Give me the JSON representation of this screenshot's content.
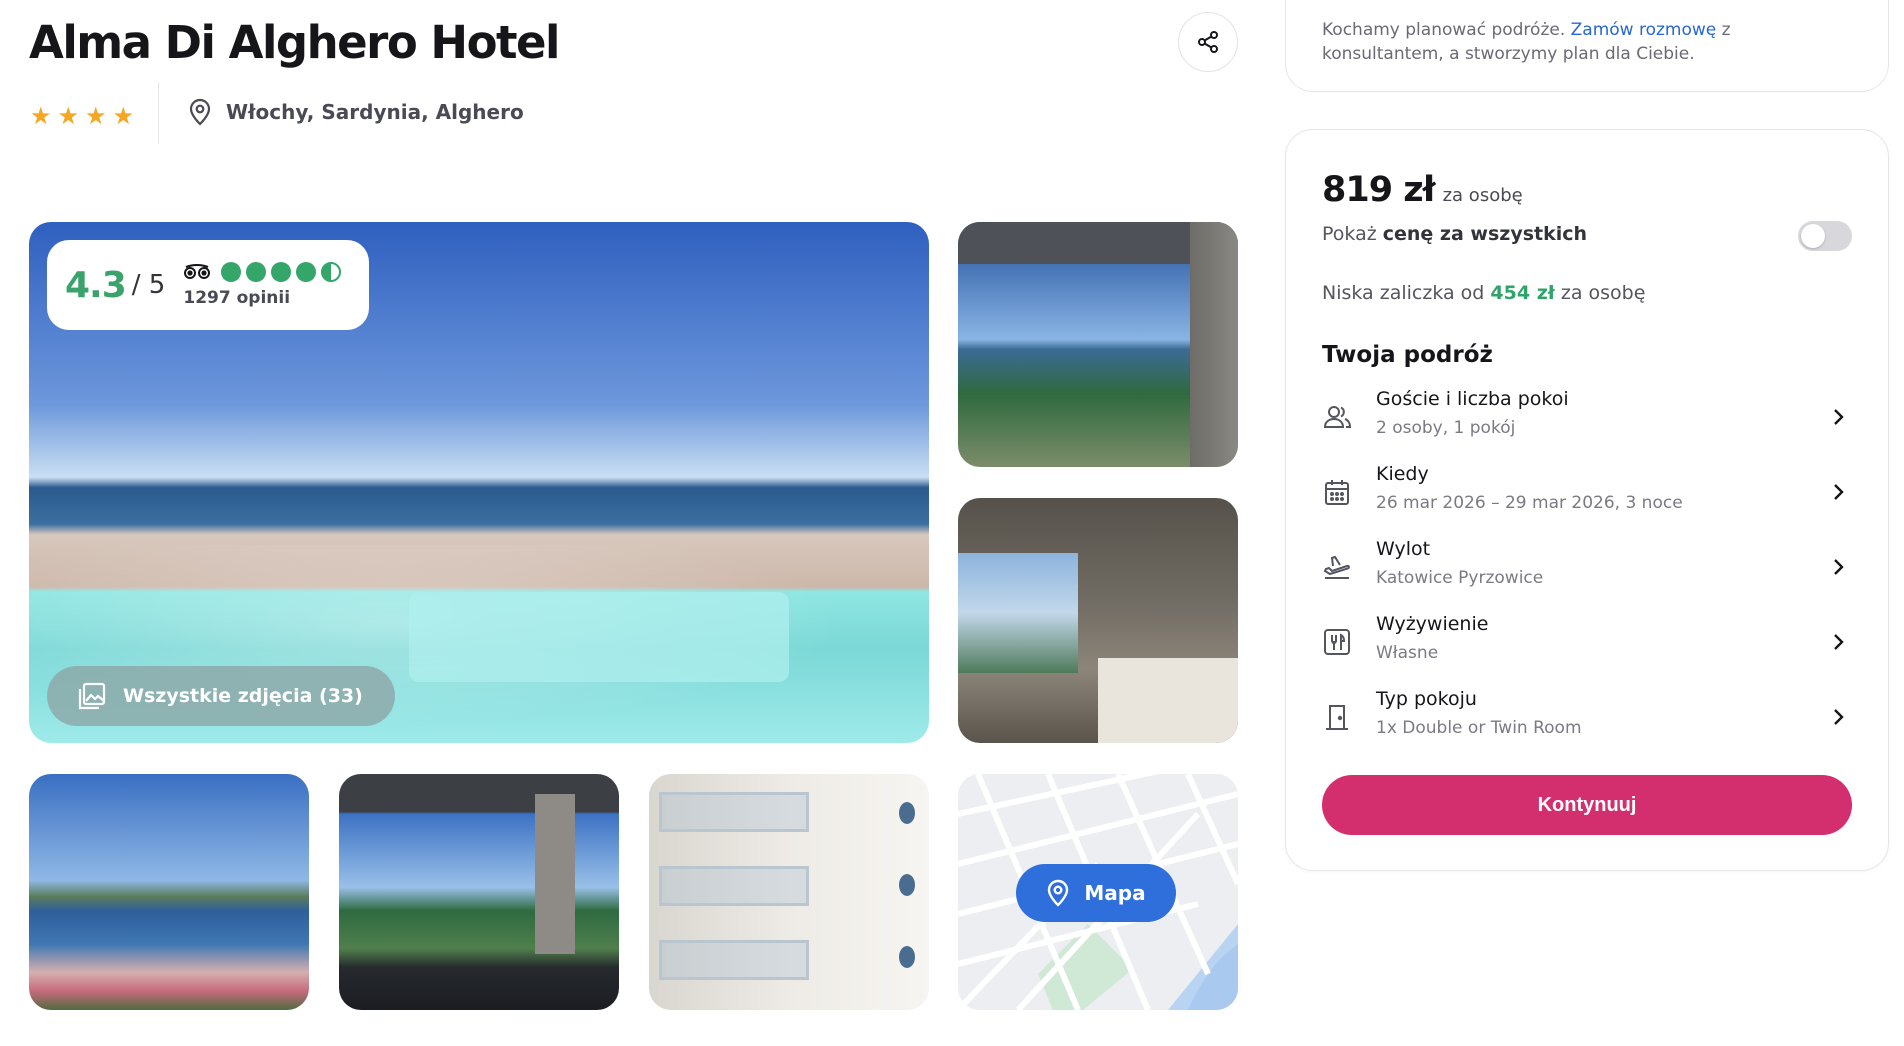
{
  "hotel": {
    "name": "Alma Di Alghero Hotel",
    "stars": 4,
    "star_glyph": "★",
    "location": "Włochy, Sardynia, Alghero"
  },
  "rating": {
    "score": "4.3",
    "max": "/ 5",
    "reviews": "1297 opinii",
    "bubbles": 4.5,
    "color": "#34a66a"
  },
  "gallery": {
    "all_photos_label": "Wszystkie zdjęcia (33)",
    "map_label": "Mapa"
  },
  "consult": {
    "text_before": "Kochamy planować podróże. ",
    "link": "Zamów rozmowę",
    "text_after": " z konsultantem, a stworzymy plan dla Ciebie."
  },
  "booking": {
    "price": "819 zł",
    "price_per": "za osobę",
    "show_all_prefix": "Pokaż ",
    "show_all_bold": "cenę za wszystkich",
    "deposit_prefix": "Niska zaliczka od ",
    "deposit_amount": "454 zł",
    "deposit_suffix": " za osobę",
    "trip_title": "Twoja podróż",
    "rows": [
      {
        "label": "Goście i liczba pokoi",
        "value": "2 osoby, 1 pokój",
        "icon": "guests-icon"
      },
      {
        "label": "Kiedy",
        "value": "26 mar 2026 – 29 mar 2026, 3 noce",
        "icon": "calendar-icon"
      },
      {
        "label": "Wylot",
        "value": "Katowice Pyrzowice",
        "icon": "plane-icon"
      },
      {
        "label": "Wyżywienie",
        "value": "Własne",
        "icon": "cutlery-icon"
      },
      {
        "label": "Typ pokoju",
        "value": "1x Double or Twin Room",
        "icon": "door-icon"
      }
    ],
    "continue_label": "Kontynuuj"
  },
  "colors": {
    "accent_pink": "#d32f6e",
    "link_blue": "#2766d6",
    "map_blue": "#2f6fdc",
    "star_gold": "#f5a623"
  }
}
